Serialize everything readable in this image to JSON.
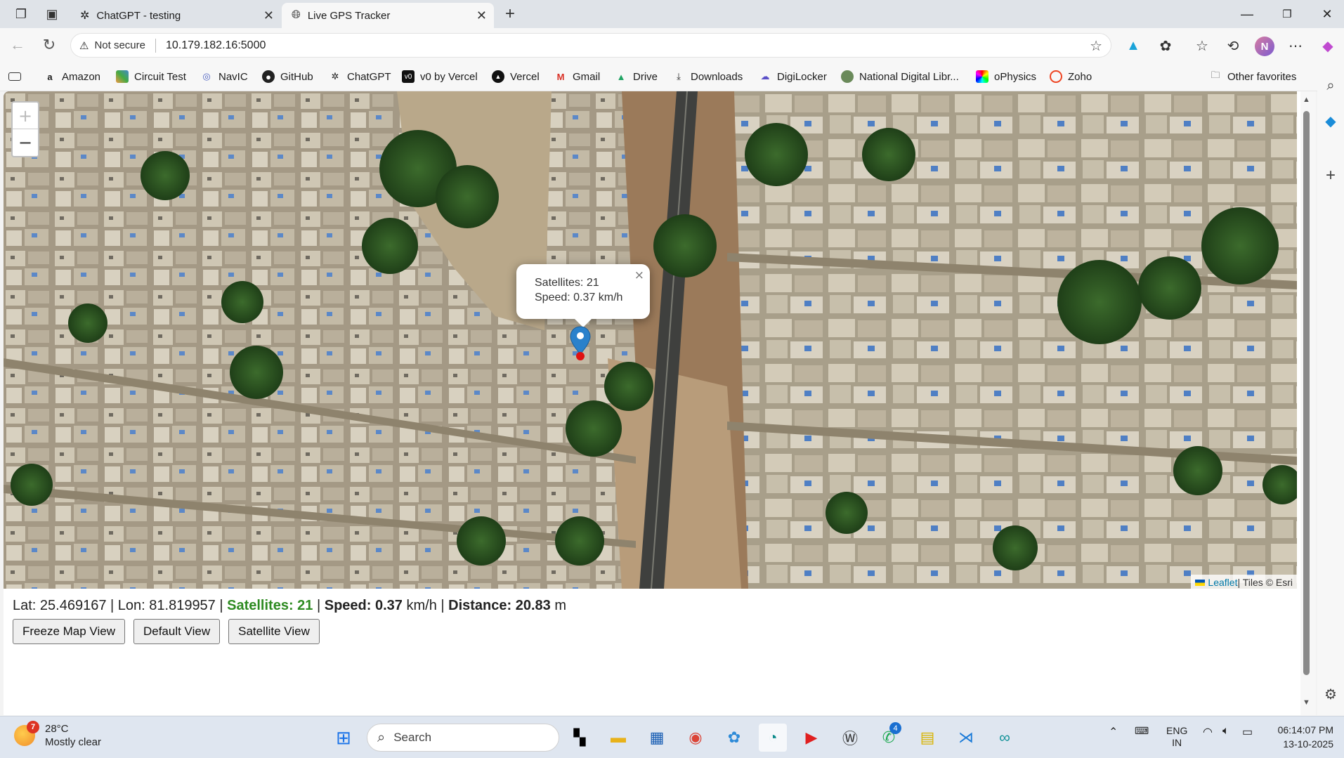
{
  "tabs": [
    {
      "title": "ChatGPT - testing",
      "active": false
    },
    {
      "title": "Live GPS Tracker",
      "active": true
    }
  ],
  "address": {
    "security_label": "Not secure",
    "url": "10.179.182.16:5000"
  },
  "favorites": [
    {
      "label": "Amazon",
      "icon": "amazon-icon"
    },
    {
      "label": "Circuit Test",
      "icon": "circuit-icon"
    },
    {
      "label": "NavIC",
      "icon": "globe-icon"
    },
    {
      "label": "GitHub",
      "icon": "github-icon"
    },
    {
      "label": "ChatGPT",
      "icon": "chatgpt-icon"
    },
    {
      "label": "v0 by Vercel",
      "icon": "v0-icon"
    },
    {
      "label": "Vercel",
      "icon": "vercel-icon"
    },
    {
      "label": "Gmail",
      "icon": "gmail-icon"
    },
    {
      "label": "Drive",
      "icon": "drive-icon"
    },
    {
      "label": "Downloads",
      "icon": "download-icon"
    },
    {
      "label": "DigiLocker",
      "icon": "digilocker-icon"
    },
    {
      "label": "National Digital Libr...",
      "icon": "library-icon"
    },
    {
      "label": "oPhysics",
      "icon": "ophysics-icon"
    },
    {
      "label": "Zoho",
      "icon": "zoho-icon"
    }
  ],
  "other_favorites": "Other favorites",
  "map": {
    "zoom_in": "+",
    "zoom_out": "−",
    "popup": {
      "line1": "Satellites: 21",
      "line2": "Speed: 0.37 km/h",
      "close": "×"
    },
    "attribution": {
      "leaflet": "Leaflet",
      "tiles": " | Tiles © Esri"
    }
  },
  "status": {
    "lat_label": "Lat: ",
    "lat": "25.469167",
    "lon_label": " | Lon: ",
    "lon": "81.819957",
    "sep1": " | ",
    "satellites": "Satellites: 21",
    "sep2": " | ",
    "speed_label": "Speed: ",
    "speed": "0.37",
    "speed_unit": " km/h",
    "sep3": " | ",
    "distance_label": "Distance: ",
    "distance": "20.83",
    "distance_unit": " m"
  },
  "buttons": {
    "freeze": "Freeze Map View",
    "default": "Default View",
    "satellite": "Satellite View"
  },
  "taskbar": {
    "weather_badge": "7",
    "temperature": "28°C",
    "condition": "Mostly clear",
    "search_placeholder": "Search",
    "whatsapp_badge": "4",
    "lang_top": "ENG",
    "lang_bottom": "IN",
    "time": "06:14:07 PM",
    "date": "13-10-2025"
  },
  "colors": {
    "satellites_text": "#2e8b22",
    "marker_blue": "#2a81cb",
    "accent_link": "#0078a8"
  }
}
